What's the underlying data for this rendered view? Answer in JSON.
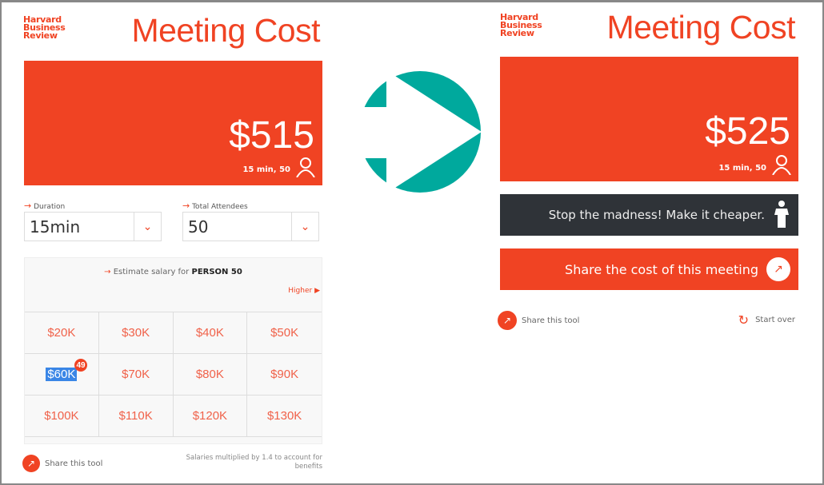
{
  "left": {
    "logo": [
      "Harvard",
      "Business",
      "Review"
    ],
    "title": "Meeting Cost",
    "cost": "$515",
    "summary": "15 min, 50",
    "duration": {
      "label": "Duration",
      "value": "15min"
    },
    "attendees": {
      "label": "Total Attendees",
      "value": "50"
    },
    "estimate_prefix": "Estimate salary for",
    "estimate_person": "PERSON 50",
    "higher": "Higher",
    "salaries": [
      "$20K",
      "$30K",
      "$40K",
      "$50K",
      "$60K",
      "$70K",
      "$80K",
      "$90K",
      "$100K",
      "$110K",
      "$120K",
      "$130K"
    ],
    "selected_badge": "49",
    "share_tool": "Share this tool",
    "footnote": "Salaries multiplied by 1.4 to account for benefits"
  },
  "right": {
    "logo": [
      "Harvard",
      "Business",
      "Review"
    ],
    "title": "Meeting Cost",
    "cost": "$525",
    "summary": "15 min, 50",
    "madness": "Stop the madness! Make it cheaper.",
    "share_cost": "Share the cost of this meeting",
    "share_tool": "Share this tool",
    "start_over": "Start over"
  },
  "colors": {
    "brand": "#f04323",
    "arrow": "#00a99d",
    "dark": "#2f3338"
  }
}
